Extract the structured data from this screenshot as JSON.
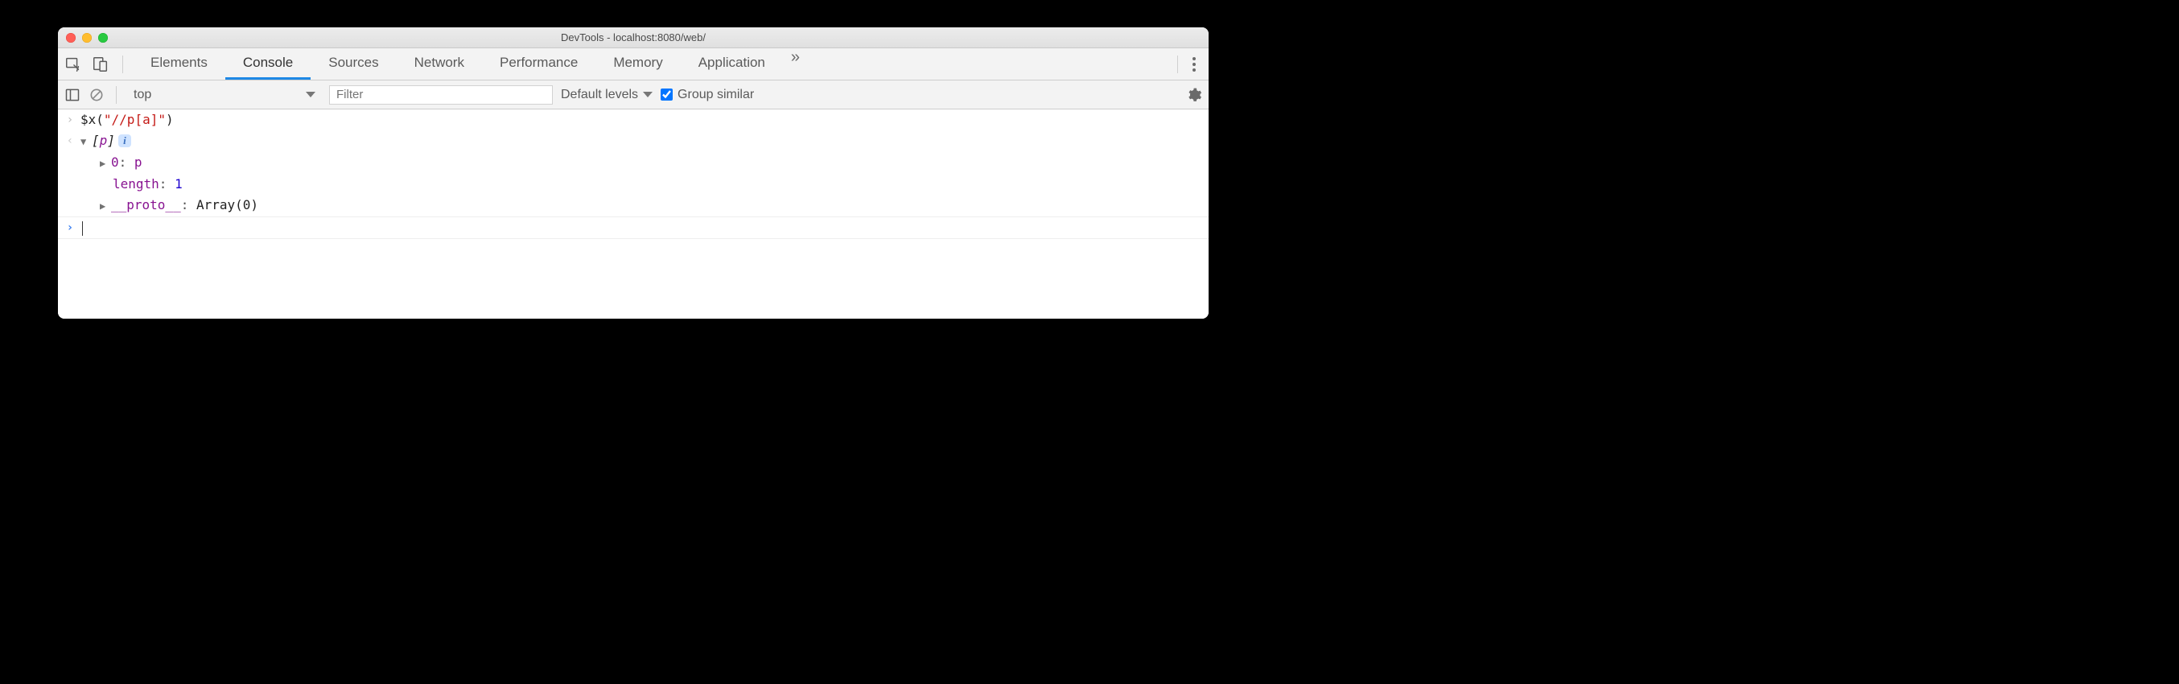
{
  "window": {
    "title": "DevTools - localhost:8080/web/"
  },
  "tabs": {
    "items": [
      {
        "label": "Elements",
        "active": false
      },
      {
        "label": "Console",
        "active": true
      },
      {
        "label": "Sources",
        "active": false
      },
      {
        "label": "Network",
        "active": false
      },
      {
        "label": "Performance",
        "active": false
      },
      {
        "label": "Memory",
        "active": false
      },
      {
        "label": "Application",
        "active": false
      }
    ]
  },
  "filterbar": {
    "context": "top",
    "filter_placeholder": "Filter",
    "levels_label": "Default levels",
    "group_similar_label": "Group similar",
    "group_similar_checked": true
  },
  "console": {
    "input_expr": {
      "fn": "$x",
      "arg": "\"//p[a]\""
    },
    "output": {
      "preview_tag": "p",
      "items": [
        {
          "key": "0",
          "val": "p",
          "expandable": true,
          "kind": "elem"
        }
      ],
      "length_key": "length",
      "length_val": "1",
      "proto_key": "__proto__",
      "proto_val": "Array(0)"
    }
  }
}
